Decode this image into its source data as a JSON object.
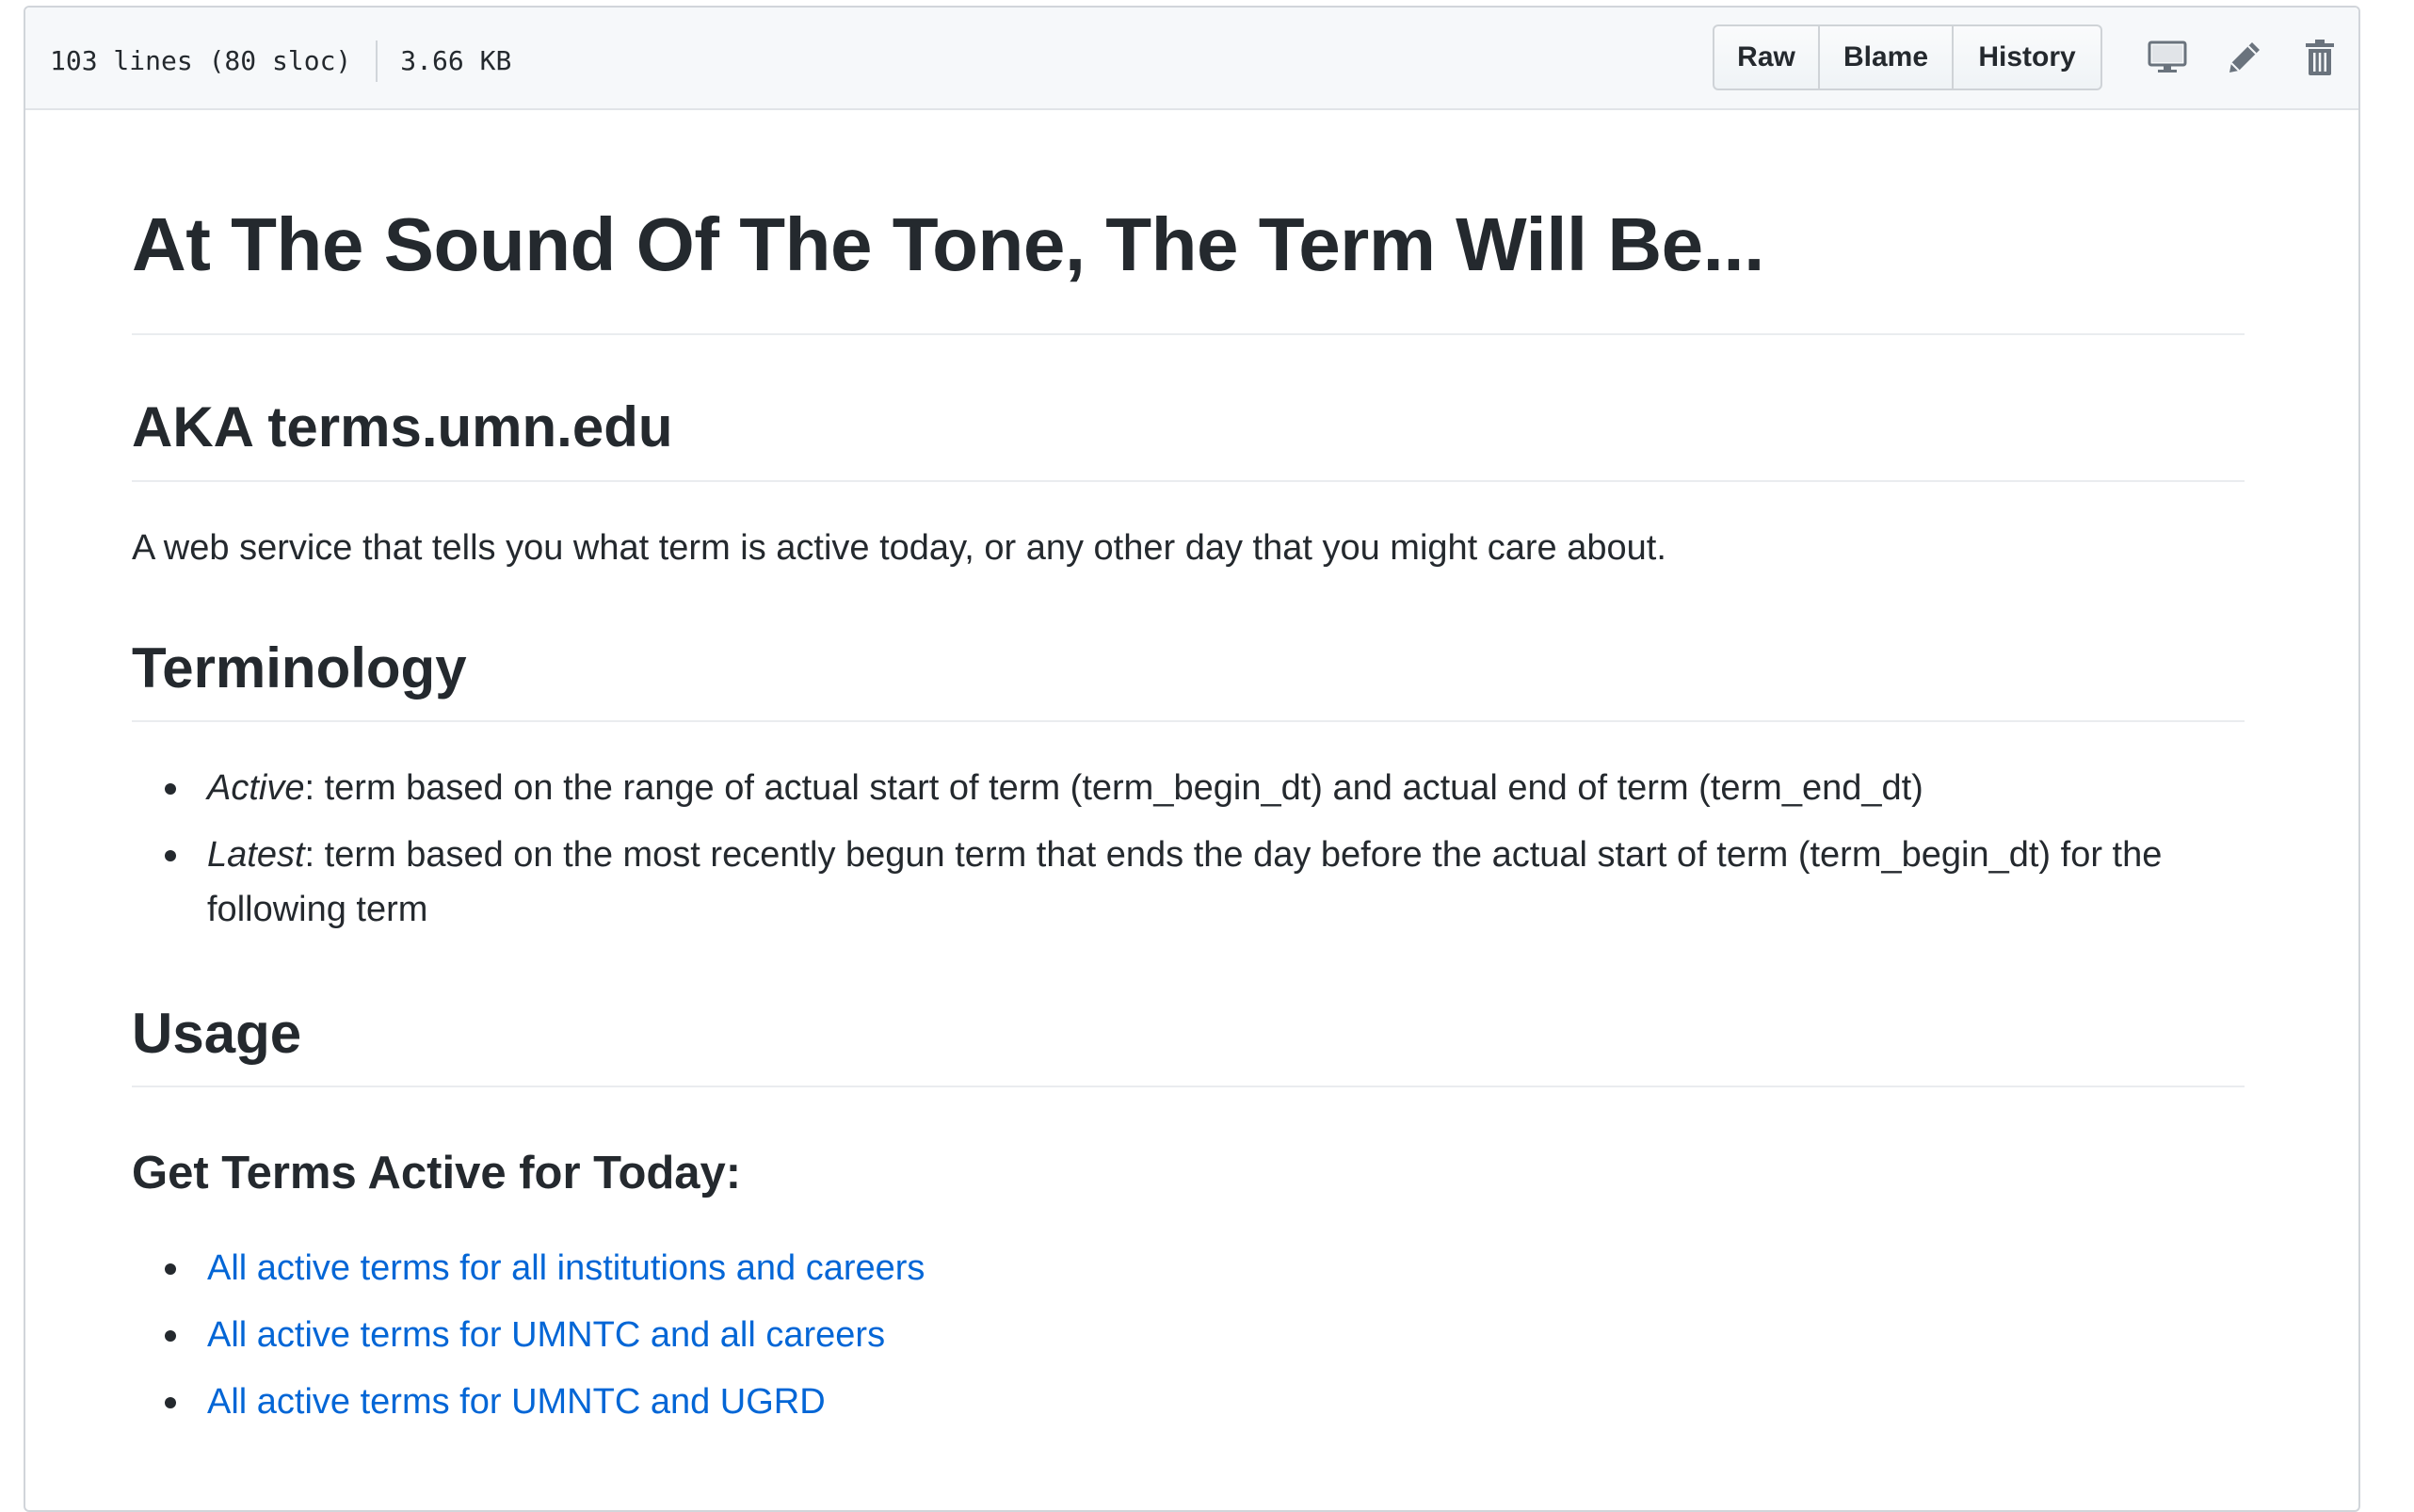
{
  "file_header": {
    "lines": "103 lines (80 sloc)",
    "size": "3.66 KB",
    "buttons": {
      "raw": "Raw",
      "blame": "Blame",
      "history": "History"
    },
    "icons": [
      "desktop-icon",
      "pencil-icon",
      "trash-icon"
    ]
  },
  "readme": {
    "title": "At The Sound Of The Tone, The Term Will Be...",
    "aka_heading": "AKA terms.umn.edu",
    "description": "A web service that tells you what term is active today, or any other day that you might care about.",
    "terminology_heading": "Terminology",
    "terminology": [
      {
        "term": "Active",
        "definition": ": term based on the range of actual start of term (term_begin_dt) and actual end of term (term_end_dt)"
      },
      {
        "term": "Latest",
        "definition": ": term based on the most recently begun term that ends the day before the actual start of term (term_begin_dt) for the following term"
      }
    ],
    "usage_heading": "Usage",
    "today_heading": "Get Terms Active for Today:",
    "today_links": [
      "All active terms for all institutions and careers",
      "All active terms for UMNTC and all careers",
      "All active terms for UMNTC and UGRD"
    ]
  },
  "colors": {
    "text": "#24292e",
    "link": "#0366d6",
    "header_bg": "#f6f8fa",
    "border": "#d1d5da"
  }
}
